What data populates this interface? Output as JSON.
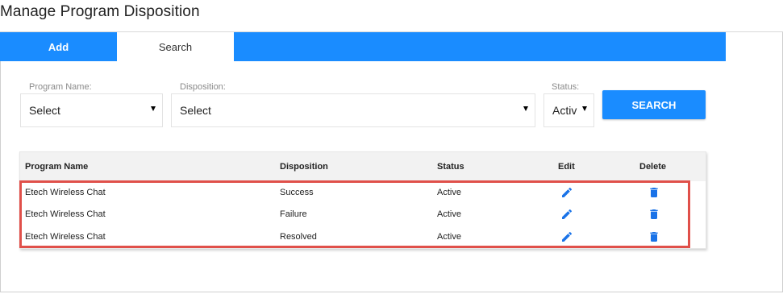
{
  "page": {
    "title": "Manage Program Disposition"
  },
  "tabs": [
    {
      "label": "Add",
      "active": false
    },
    {
      "label": "Search",
      "active": true
    }
  ],
  "filters": {
    "program_name": {
      "label": "Program Name:",
      "value": "Select"
    },
    "disposition": {
      "label": "Disposition:",
      "value": "Select"
    },
    "status": {
      "label": "Status:",
      "value": "Activ"
    }
  },
  "search_button": {
    "label": "SEARCH"
  },
  "table": {
    "headers": [
      "Program Name",
      "Disposition",
      "Status",
      "Edit",
      "Delete"
    ],
    "rows": [
      {
        "program": "Etech Wireless Chat",
        "disposition": "Success",
        "status": "Active"
      },
      {
        "program": "Etech Wireless Chat",
        "disposition": "Failure",
        "status": "Active"
      },
      {
        "program": "Etech Wireless Chat",
        "disposition": "Resolved",
        "status": "Active"
      }
    ]
  },
  "icons": {
    "edit": "pencil-icon",
    "delete": "trash-icon"
  },
  "colors": {
    "accent": "#1a8cff",
    "highlight": "#e0504a",
    "header_bg": "#f2f2f2"
  }
}
